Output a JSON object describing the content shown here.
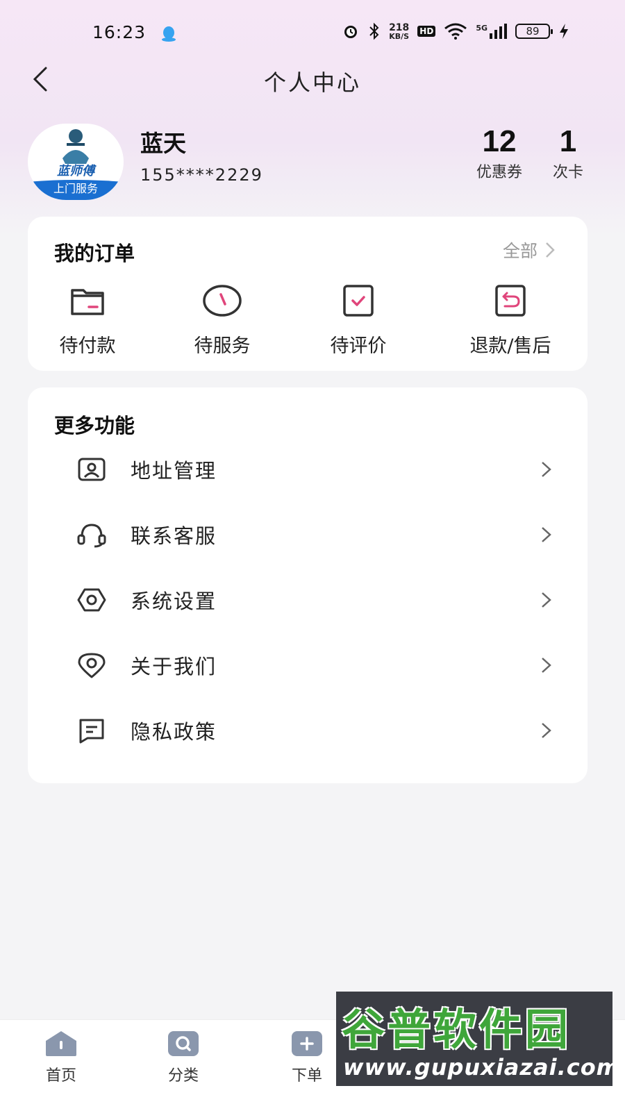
{
  "status_bar": {
    "time": "16:23",
    "net_speed_value": "218",
    "net_speed_unit": "KB/S",
    "hd": "HD",
    "network": "5G",
    "battery": "89"
  },
  "header": {
    "title": "个人中心"
  },
  "profile": {
    "name": "蓝天",
    "phone": "155****2229",
    "avatar_brand": "蓝师傅",
    "avatar_tagline": "上门服务",
    "stats": [
      {
        "value": "12",
        "label": "优惠券"
      },
      {
        "value": "1",
        "label": "次卡"
      }
    ]
  },
  "orders": {
    "title": "我的订单",
    "see_all": "全部",
    "items": [
      {
        "label": "待付款",
        "icon": "wallet-icon"
      },
      {
        "label": "待服务",
        "icon": "clock-icon"
      },
      {
        "label": "待评价",
        "icon": "check-box-icon"
      },
      {
        "label": "退款/售后",
        "icon": "return-icon"
      }
    ]
  },
  "more": {
    "title": "更多功能",
    "items": [
      {
        "label": "地址管理",
        "icon": "address-card-icon"
      },
      {
        "label": "联系客服",
        "icon": "headset-icon"
      },
      {
        "label": "系统设置",
        "icon": "settings-hexagon-icon"
      },
      {
        "label": "关于我们",
        "icon": "location-pin-icon"
      },
      {
        "label": "隐私政策",
        "icon": "document-icon"
      }
    ]
  },
  "tab_bar": {
    "tabs": [
      {
        "label": "首页",
        "icon": "home-icon"
      },
      {
        "label": "分类",
        "icon": "search-icon"
      },
      {
        "label": "下单",
        "icon": "plus-icon"
      }
    ]
  },
  "watermark": {
    "main": "谷普软件园",
    "url": "www.gupuxiazai.com"
  },
  "colors": {
    "accent": "#e0457b",
    "tab_icon": "#8a97ad",
    "avatar_blue": "#1a6fd1"
  }
}
